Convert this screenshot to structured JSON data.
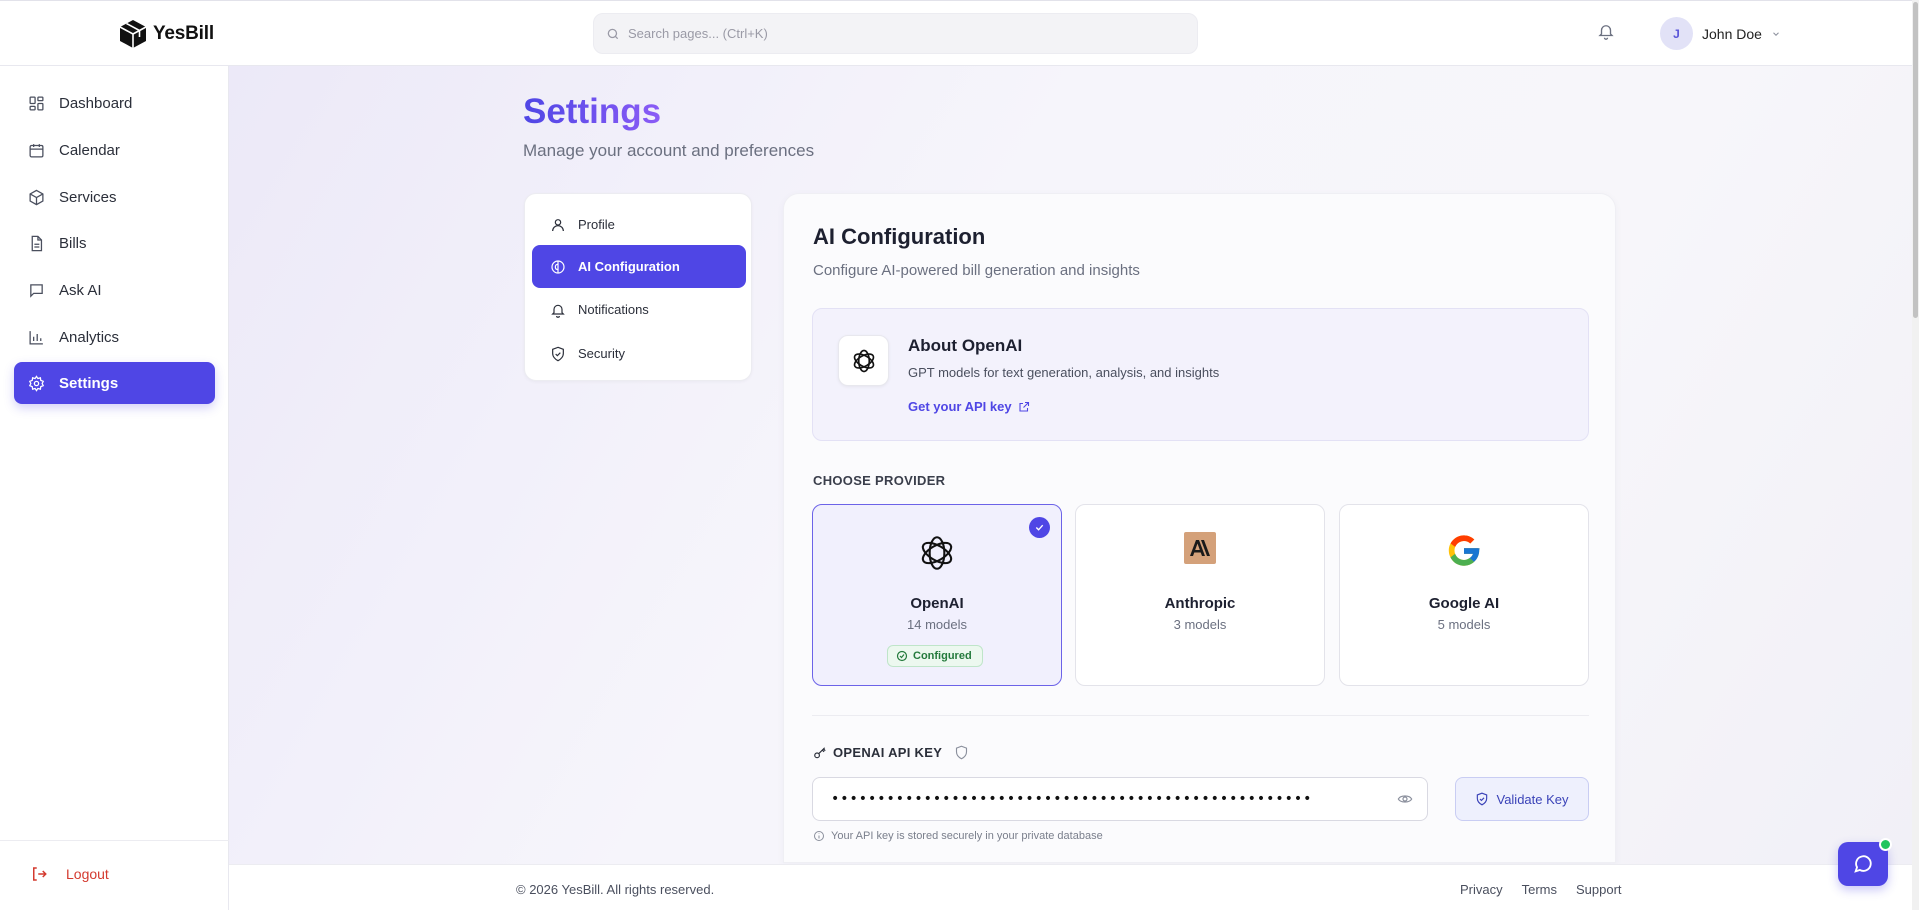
{
  "brand": {
    "name": "YesBill",
    "logo_icon": "cube-logo"
  },
  "search": {
    "placeholder": "Search pages... (Ctrl+K)",
    "value": ""
  },
  "user": {
    "initial": "J",
    "name": "John Doe"
  },
  "sidebar": {
    "items": [
      {
        "label": "Dashboard",
        "icon": "grid-icon"
      },
      {
        "label": "Calendar",
        "icon": "calendar-icon"
      },
      {
        "label": "Services",
        "icon": "box-icon"
      },
      {
        "label": "Bills",
        "icon": "file-icon"
      },
      {
        "label": "Ask AI",
        "icon": "chat-icon"
      },
      {
        "label": "Analytics",
        "icon": "bar-chart-icon"
      },
      {
        "label": "Settings",
        "icon": "gear-icon",
        "active": true
      }
    ],
    "logout": "Logout"
  },
  "page": {
    "title": "Settings",
    "subtitle": "Manage your account and preferences"
  },
  "settings_nav": {
    "items": [
      {
        "label": "Profile",
        "icon": "user-icon"
      },
      {
        "label": "AI Configuration",
        "icon": "brain-icon",
        "active": true
      },
      {
        "label": "Notifications",
        "icon": "bell-icon"
      },
      {
        "label": "Security",
        "icon": "shield-icon"
      }
    ]
  },
  "ai_config": {
    "title": "AI Configuration",
    "subtitle": "Configure AI-powered bill generation and insights",
    "about": {
      "title": "About OpenAI",
      "description": "GPT models for text generation, analysis, and insights",
      "link": "Get your API key"
    },
    "choose_provider_label": "CHOOSE PROVIDER",
    "providers": [
      {
        "name": "OpenAI",
        "models": "14 models",
        "selected": true,
        "badge": "Configured"
      },
      {
        "name": "Anthropic",
        "models": "3 models",
        "selected": false
      },
      {
        "name": "Google AI",
        "models": "5 models",
        "selected": false
      }
    ],
    "api_key": {
      "label": "OPENAI API KEY",
      "value": "••••••••••••••••••••••••••••••••••••••••••••••••••••",
      "validate_label": "Validate Key",
      "hint": "Your API key is stored securely in your private database"
    }
  },
  "footer": {
    "copyright": "© 2026 YesBill. All rights reserved.",
    "links": [
      "Privacy",
      "Terms",
      "Support"
    ]
  },
  "colors": {
    "accent": "#4f46e5",
    "danger": "#d43a2f",
    "success": "#247a3c"
  }
}
